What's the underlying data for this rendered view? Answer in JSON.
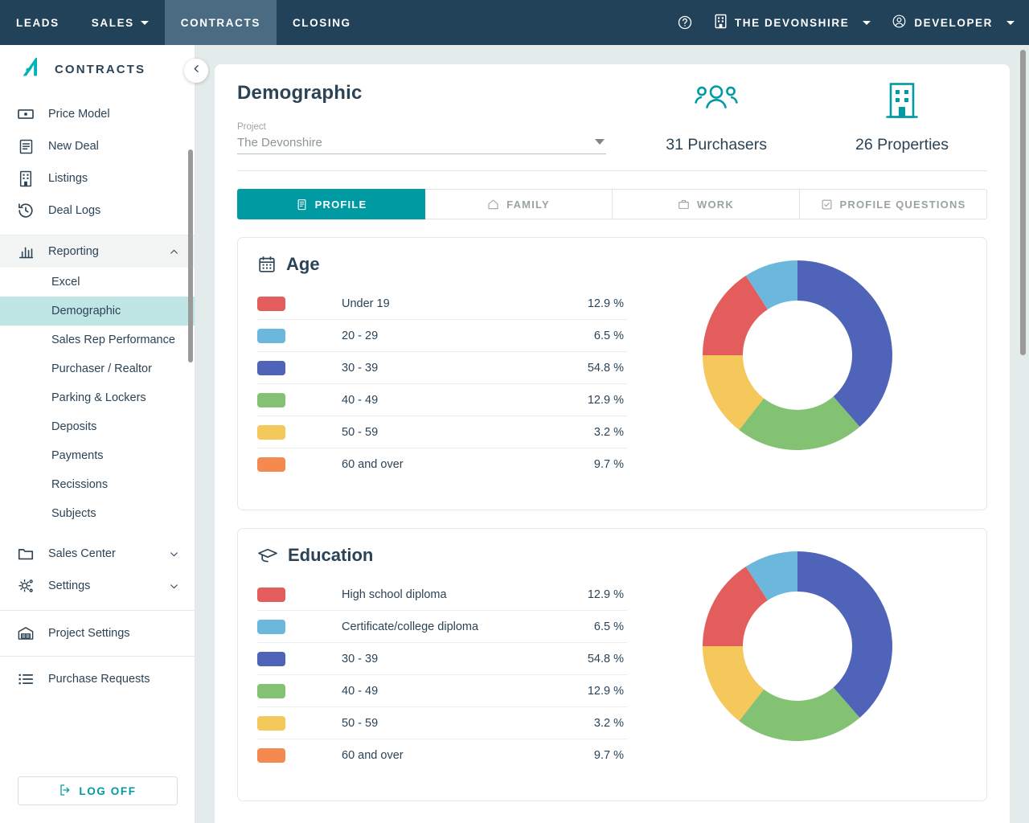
{
  "topnav": {
    "items": [
      {
        "label": "LEADS",
        "caret": false,
        "active": false
      },
      {
        "label": "SALES",
        "caret": true,
        "active": false
      },
      {
        "label": "CONTRACTS",
        "caret": false,
        "active": true
      },
      {
        "label": "CLOSING",
        "caret": false,
        "active": false
      }
    ],
    "help_icon": "help-circle-icon",
    "project_label": "THE DEVONSHIRE",
    "project_icon": "building-icon",
    "user_label": "DEVELOPER",
    "user_icon": "user-circle-icon",
    "bg_color": "#22425a",
    "active_bg_color": "#4b6b83"
  },
  "sidebar": {
    "brand": "CONTRACTS",
    "brand_icon": "app-logo-icon",
    "collapse_icon": "chevron-left-icon",
    "primary_items": [
      {
        "label": "Price Model",
        "icon": "money-bill-icon"
      },
      {
        "label": "New Deal",
        "icon": "document-icon"
      },
      {
        "label": "Listings",
        "icon": "building-icon"
      },
      {
        "label": "Deal Logs",
        "icon": "history-clock-icon"
      }
    ],
    "reporting": {
      "label": "Reporting",
      "icon": "bar-chart-icon",
      "expanded": true,
      "chevron": "chevron-up-icon",
      "children": [
        {
          "label": "Excel",
          "active": false
        },
        {
          "label": "Demographic",
          "active": true
        },
        {
          "label": "Sales Rep Performance",
          "active": false
        },
        {
          "label": "Purchaser / Realtor",
          "active": false
        },
        {
          "label": "Parking & Lockers",
          "active": false
        },
        {
          "label": "Deposits",
          "active": false
        },
        {
          "label": "Payments",
          "active": false
        },
        {
          "label": "Recissions",
          "active": false
        },
        {
          "label": "Subjects",
          "active": false
        }
      ]
    },
    "collapsible_items": [
      {
        "label": "Sales Center",
        "icon": "folder-icon",
        "chevron": "chevron-down-icon"
      },
      {
        "label": "Settings",
        "icon": "gears-icon",
        "chevron": "chevron-down-icon"
      }
    ],
    "project_settings": {
      "label": "Project Settings",
      "icon": "warehouse-icon"
    },
    "purchase_requests": {
      "label": "Purchase Requests",
      "icon": "list-icon"
    },
    "logoff": {
      "label": "LOG OFF",
      "icon": "logout-icon",
      "color": "#009aa3"
    },
    "active_item_color": "#bfe5e5"
  },
  "main": {
    "title": "Demographic",
    "project_select": {
      "label": "Project",
      "value": "The Devonshire",
      "caret_icon": "chevron-down-icon"
    },
    "stats": [
      {
        "value": "31 Purchasers",
        "icon": "people-group-icon"
      },
      {
        "value": "26 Properties",
        "icon": "building-icon"
      }
    ],
    "accent_color": "#009aa3",
    "tabs": [
      {
        "label": "PROFILE",
        "icon": "profile-card-icon",
        "active": true
      },
      {
        "label": "FAMILY",
        "icon": "home-icon",
        "active": false
      },
      {
        "label": "WORK",
        "icon": "briefcase-icon",
        "active": false
      },
      {
        "label": "PROFILE QUESTIONS",
        "icon": "checkbox-icon",
        "active": false
      }
    ]
  },
  "chart_data": [
    {
      "type": "pie",
      "title": "Age",
      "title_icon": "calendar-icon",
      "value_suffix": "%",
      "categories": [
        "Under 19",
        "20 - 29",
        "30 - 39",
        "40 - 49",
        "50 - 59",
        "60 and over"
      ],
      "values": [
        12.9,
        6.5,
        54.8,
        12.9,
        3.2,
        9.7
      ],
      "labels": [
        "12.9 %",
        "6.5 %",
        "54.8 %",
        "12.9 %",
        "3.2 %",
        "9.7 %"
      ],
      "colors": [
        "#e35d5d",
        "#6bb8dc",
        "#4f63b8",
        "#82c272",
        "#f5c85c",
        "#f58a50"
      ],
      "donut_segments": [
        {
          "name": "30 - 39",
          "color": "#4f63b8",
          "start_deg": 0,
          "end_deg": 139
        },
        {
          "name": "40 - 49",
          "color": "#82c272",
          "start_deg": 139,
          "end_deg": 218
        },
        {
          "name": "50 - 59",
          "color": "#f5c85c",
          "start_deg": 218,
          "end_deg": 270
        },
        {
          "name": "Under 19",
          "color": "#e35d5d",
          "start_deg": 270,
          "end_deg": 327
        },
        {
          "name": "20 - 29",
          "color": "#6bb8dc",
          "start_deg": 327,
          "end_deg": 360
        }
      ],
      "legend": "left-list",
      "grid": false
    },
    {
      "type": "pie",
      "title": "Education",
      "title_icon": "graduation-cap-icon",
      "value_suffix": "%",
      "categories": [
        "High school diploma",
        "Certificate/college diploma",
        "30 - 39",
        "40 - 49",
        "50 - 59",
        "60 and over"
      ],
      "values": [
        12.9,
        6.5,
        54.8,
        12.9,
        3.2,
        9.7
      ],
      "labels": [
        "12.9 %",
        "6.5 %",
        "54.8 %",
        "12.9 %",
        "3.2 %",
        "9.7 %"
      ],
      "colors": [
        "#e35d5d",
        "#6bb8dc",
        "#4f63b8",
        "#82c272",
        "#f5c85c",
        "#f58a50"
      ],
      "donut_segments": [
        {
          "name": "30 - 39",
          "color": "#4f63b8",
          "start_deg": 0,
          "end_deg": 139
        },
        {
          "name": "40 - 49",
          "color": "#82c272",
          "start_deg": 139,
          "end_deg": 218
        },
        {
          "name": "50 - 59",
          "color": "#f5c85c",
          "start_deg": 218,
          "end_deg": 270
        },
        {
          "name": "High school diploma",
          "color": "#e35d5d",
          "start_deg": 270,
          "end_deg": 327
        },
        {
          "name": "Certificate/college diploma",
          "color": "#6bb8dc",
          "start_deg": 327,
          "end_deg": 360
        }
      ],
      "legend": "left-list",
      "grid": false
    }
  ]
}
